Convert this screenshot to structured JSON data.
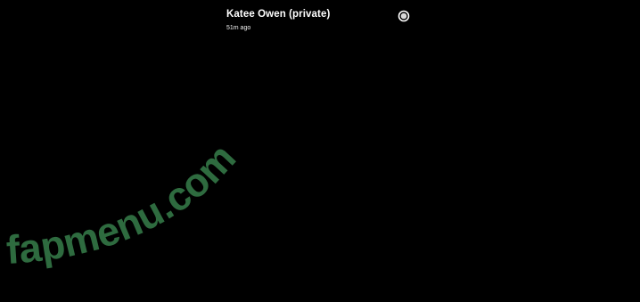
{
  "story": {
    "title": "Katee Owen (private)",
    "time": "51m ago",
    "more_icon": "more-circle-icon"
  },
  "watermark": {
    "text": "fapmenu.com",
    "color": "#2E6B3F"
  },
  "colors": {
    "background": "#000000",
    "text": "#FFFFFF"
  }
}
